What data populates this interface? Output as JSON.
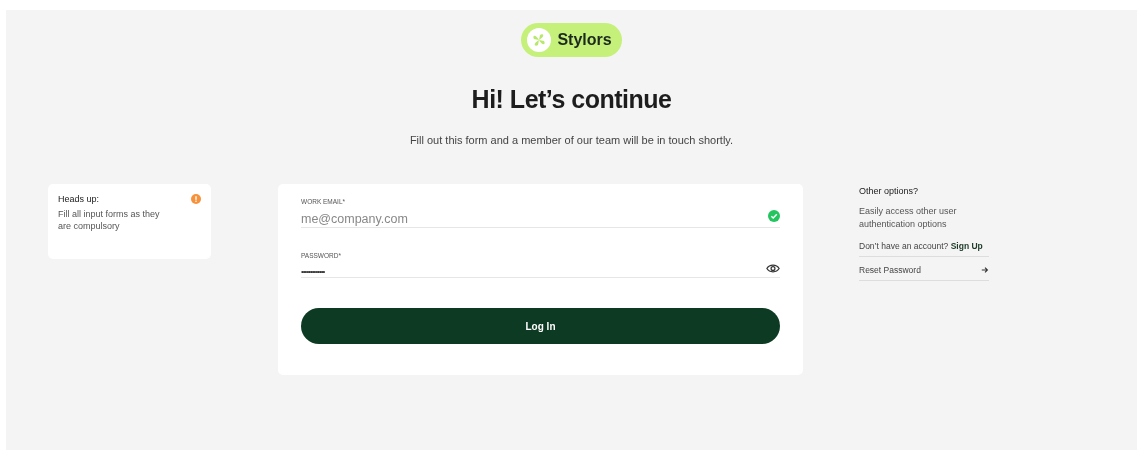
{
  "logo": {
    "name": "Stylors"
  },
  "heading": "Hi! Let’s continue",
  "subtitle": "Fill out this form and a member of our team will be in touch shortly.",
  "notice": {
    "title": "Heads up:",
    "text": "Fill all input forms as they are compulsory"
  },
  "form": {
    "fields": [
      {
        "kind": "email",
        "label": "WORK EMAIL*",
        "placeholder": "me@company.com",
        "valid": true
      },
      {
        "kind": "password",
        "label": "PASSWORD*",
        "value": "•••••••••••••"
      }
    ],
    "submit": "Log In"
  },
  "options": {
    "title": "Other options?",
    "text": "Easily access other user authentication options",
    "links": [
      {
        "text": "Don’t have an account?",
        "link": "Sign Up"
      },
      {
        "text": "Reset Password"
      }
    ]
  }
}
